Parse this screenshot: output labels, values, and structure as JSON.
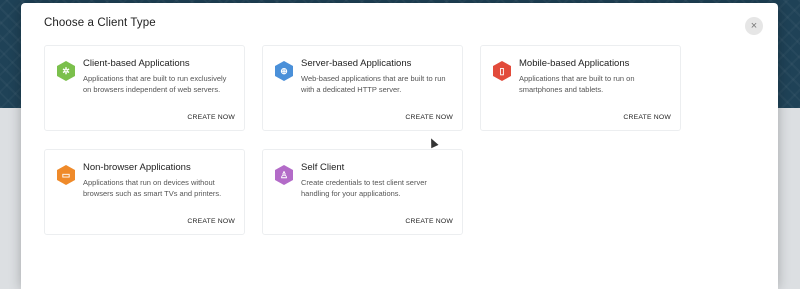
{
  "dialog": {
    "title": "Choose a Client Type",
    "close_label": "×"
  },
  "cards": [
    {
      "title": "Client-based Applications",
      "description": "Applications that are built to run exclusively on browsers independent of web servers.",
      "cta": "CREATE NOW",
      "icon": "puzzle-icon",
      "icon_glyph": "✲",
      "color": "#7bc04c"
    },
    {
      "title": "Server-based Applications",
      "description": "Web-based applications that are built to run with a dedicated HTTP server.",
      "cta": "CREATE NOW",
      "icon": "globe-icon",
      "icon_glyph": "⊕",
      "color": "#4a90d9"
    },
    {
      "title": "Mobile-based Applications",
      "description": "Applications that are built to run on smartphones and tablets.",
      "cta": "CREATE NOW",
      "icon": "mobile-icon",
      "icon_glyph": "▯",
      "color": "#e24b3b"
    },
    {
      "title": "Non-browser Applications",
      "description": "Applications that run on devices without browsers such as smart TVs and printers.",
      "cta": "CREATE NOW",
      "icon": "monitor-icon",
      "icon_glyph": "▭",
      "color": "#ef8a2a"
    },
    {
      "title": "Self Client",
      "description": "Create credentials to test client server handling for your applications.",
      "cta": "CREATE NOW",
      "icon": "user-icon",
      "icon_glyph": "♙",
      "color": "#b36bc8"
    }
  ]
}
